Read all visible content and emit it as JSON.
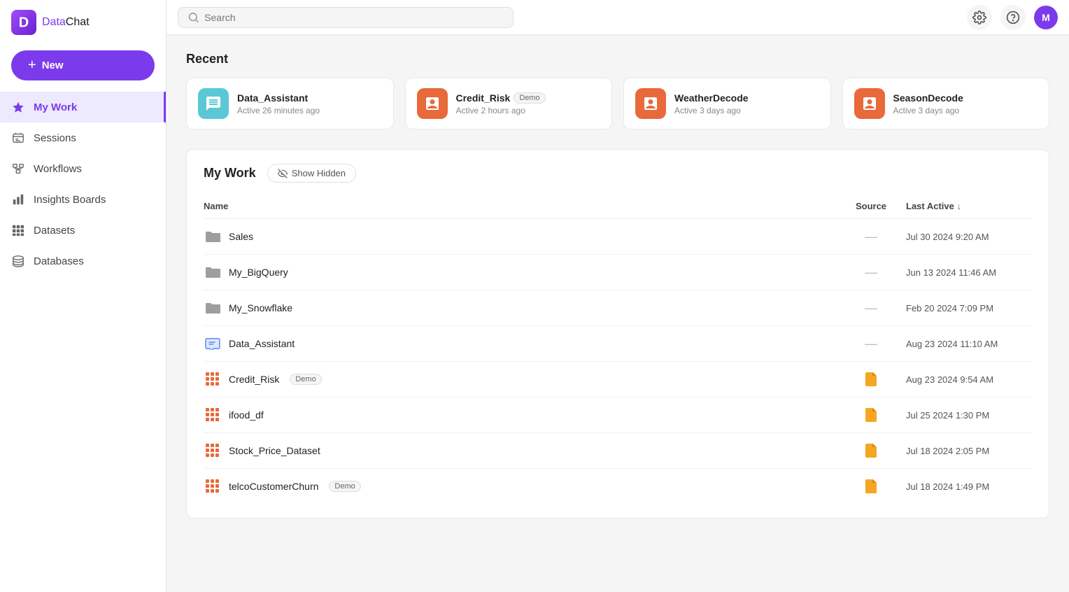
{
  "app": {
    "name": "DataChat",
    "name_data": "Data",
    "name_chat": "Chat"
  },
  "header": {
    "search_placeholder": "Search",
    "user_initial": "M"
  },
  "sidebar": {
    "new_button": "New",
    "items": [
      {
        "id": "my-work",
        "label": "My Work",
        "active": true
      },
      {
        "id": "sessions",
        "label": "Sessions",
        "active": false
      },
      {
        "id": "workflows",
        "label": "Workflows",
        "active": false
      },
      {
        "id": "insights-boards",
        "label": "Insights Boards",
        "active": false
      },
      {
        "id": "datasets",
        "label": "Datasets",
        "active": false
      },
      {
        "id": "databases",
        "label": "Databases",
        "active": false
      }
    ]
  },
  "recent": {
    "title": "Recent",
    "cards": [
      {
        "id": "data-assistant",
        "name": "Data_Assistant",
        "time": "Active 26 minutes ago",
        "color": "#5bc8d6",
        "demo": false
      },
      {
        "id": "credit-risk",
        "name": "Credit_Risk",
        "time": "Active 2 hours ago",
        "color": "#e8693a",
        "demo": true
      },
      {
        "id": "weather-decode",
        "name": "WeatherDecode",
        "time": "Active 3 days ago",
        "color": "#e8693a",
        "demo": false
      },
      {
        "id": "season-decode",
        "name": "SeasonDecode",
        "time": "Active 3 days ago",
        "color": "#e8693a",
        "demo": false
      }
    ]
  },
  "my_work": {
    "title": "My Work",
    "show_hidden_label": "Show Hidden",
    "columns": {
      "name": "Name",
      "source": "Source",
      "last_active": "Last Active"
    },
    "rows": [
      {
        "id": "sales",
        "name": "Sales",
        "type": "folder",
        "source": "dash",
        "last_active": "Jul 30 2024 9:20 AM",
        "demo": false
      },
      {
        "id": "my-bigquery",
        "name": "My_BigQuery",
        "type": "folder",
        "source": "dash",
        "last_active": "Jun 13 2024 11:46 AM",
        "demo": false
      },
      {
        "id": "my-snowflake",
        "name": "My_Snowflake",
        "type": "folder",
        "source": "dash",
        "last_active": "Feb 20 2024 7:09 PM",
        "demo": false
      },
      {
        "id": "data-assistant-row",
        "name": "Data_Assistant",
        "type": "session",
        "source": "dash",
        "last_active": "Aug 23 2024 11:10 AM",
        "demo": false
      },
      {
        "id": "credit-risk-row",
        "name": "Credit_Risk",
        "type": "dataset",
        "source": "file",
        "last_active": "Aug 23 2024 9:54 AM",
        "demo": true
      },
      {
        "id": "ifood-df",
        "name": "ifood_df",
        "type": "dataset",
        "source": "file",
        "last_active": "Jul 25 2024 1:30 PM",
        "demo": false
      },
      {
        "id": "stock-price-dataset",
        "name": "Stock_Price_Dataset",
        "type": "dataset",
        "source": "file",
        "last_active": "Jul 18 2024 2:05 PM",
        "demo": false
      },
      {
        "id": "telco-customer-churn",
        "name": "telcoCustomerChurn",
        "type": "dataset",
        "source": "file",
        "last_active": "Jul 18 2024 1:49 PM",
        "demo": true
      }
    ]
  }
}
